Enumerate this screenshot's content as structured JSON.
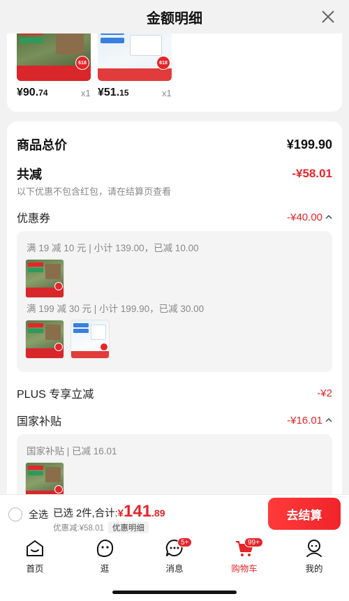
{
  "header": {
    "title": "金额明细"
  },
  "products": [
    {
      "price_main": "¥90.",
      "price_cents": "74",
      "qty": "x1"
    },
    {
      "price_main": "¥51.",
      "price_cents": "15",
      "qty": "x1"
    }
  ],
  "summary": {
    "total_label": "商品总价",
    "total_value": "¥199.90",
    "reduce_label": "共减",
    "reduce_value": "-¥58.01",
    "note": "以下优惠不包含红包，请在结算页查看",
    "coupon_label": "优惠券",
    "coupon_value": "-¥40.00",
    "coupon_lines": [
      "满 19 减 10 元 | 小计 139.00，已减 10.00",
      "满 199 减 30 元 | 小计 199.90，已减 30.00"
    ],
    "plus_label": "PLUS 专享立减",
    "plus_value": "-¥2",
    "subsidy_label": "国家补贴",
    "subsidy_value": "-¥16.01",
    "subsidy_line": "国家补贴 | 已减 16.01"
  },
  "checkout": {
    "select_all": "全选",
    "selected_text": "已选 2件,合计:",
    "total_symbol": "¥",
    "total_int": "141",
    "total_cents": ".89",
    "discount_text": "优惠减:¥58.01",
    "detail_label": "优惠明细",
    "button_label": "去结算"
  },
  "tabbar": {
    "items": [
      {
        "label": "首页"
      },
      {
        "label": "逛"
      },
      {
        "label": "消息",
        "badge": "5+"
      },
      {
        "label": "购物车",
        "badge": "99+"
      },
      {
        "label": "我的"
      }
    ]
  },
  "colors": {
    "accent": "#e5252a",
    "background": "#f2f2f2"
  }
}
